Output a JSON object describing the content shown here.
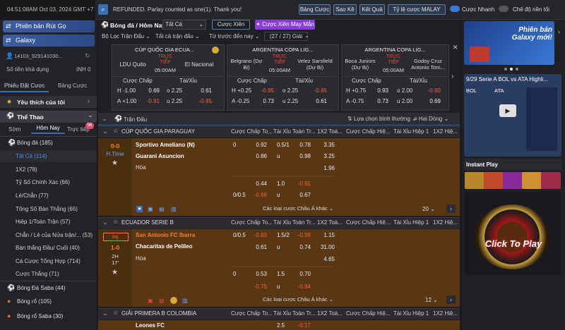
{
  "topbar": {
    "clock": "04:51:08AM Oct 03, 2024 GMT +7",
    "notice": "REFUNDED. Parlay counted as one(1). Thank you!",
    "buttons": [
      "Bảng Cược",
      "Sao Kê",
      "Kết Quả",
      "Tỷ lệ cược MALAY"
    ],
    "quick_bet_label": "Cược Nhanh",
    "dark_mode_label": "Chế độ nền tối"
  },
  "sidebar": {
    "promo1": "Phiên bản Rút Gọ",
    "promo2": "Galaxy",
    "user_id": "14103_929141030...",
    "balance_label": "Số tiền khả dụng",
    "balance_value": "INH 0",
    "tabs": [
      "Phiếu Đặt Cược",
      "Bảng Cược"
    ],
    "favorites": "Yêu thích của tôi",
    "sports_label": "Thể Thao",
    "time_tabs": [
      "Sớm",
      "Hôm Nay",
      "Trực tiếp"
    ],
    "live_badge": "56",
    "football": {
      "label": "Bóng đá",
      "count": "(185)"
    },
    "sub_items": [
      {
        "label": "Tất Cả",
        "count": "(114)"
      },
      {
        "label": "1X2",
        "count": "(78)"
      },
      {
        "label": "Tỷ Số Chính Xác",
        "count": "(66)"
      },
      {
        "label": "Lẻ/Chẵn",
        "count": "(77)"
      },
      {
        "label": "Tổng Số Bàn Thắng",
        "count": "(65)"
      },
      {
        "label": "Hiệp 1/Toàn Trận",
        "count": "(57)"
      },
      {
        "label": "Chẵn / Lẻ của Nửa trận/...",
        "count": "(53)"
      },
      {
        "label": "Bàn thắng Đầu/ Cuối",
        "count": "(40)"
      },
      {
        "label": "Cá Cược Tổng Hợp",
        "count": "(714)"
      },
      {
        "label": "Cược Thắng",
        "count": "(71)"
      }
    ],
    "other_sports": [
      {
        "label": "Bóng Đá Saba",
        "count": "(44)"
      },
      {
        "label": "Bóng rổ",
        "count": "(105)"
      },
      {
        "label": "Bóng rổ Saba",
        "count": "(30)"
      }
    ]
  },
  "main": {
    "breadcrumb": "Bóng đá / Hôm Nay",
    "filter_all": "Tất Cả",
    "parlay_btn": "Cược Xiên",
    "lucky_parlay_btn": "Cược Xiên May Mắn",
    "filters": [
      "Bộ Lọc Trận Đấu",
      "Tất cả trận đấu",
      "Từ trước đến nay",
      "(27 / 27) Giải"
    ],
    "live_label": "TRỰC TIẾP",
    "featured": [
      {
        "league": "CÚP QUỐC GIA ECUA...",
        "home": "LDU Quito",
        "away": "El Nacional",
        "time": "05:00AM",
        "hdp_label": "Cược Chấp",
        "ou_label": "Tài/Xỉu",
        "rows": [
          [
            "H",
            "-1.00",
            "0.69",
            "o",
            "2.25",
            "0.61"
          ],
          [
            "A",
            "+1.00",
            "-0.91",
            "u",
            "2.25",
            "-0.85"
          ]
        ]
      },
      {
        "league": "ARGENTINA COPA LIG...",
        "home": "Belgrano (Dự Bị)",
        "away": "Velez Sarsfield (Dự Bị)",
        "time": "05:00AM",
        "hdp_label": "Cược Chấp",
        "ou_label": "Tài/Xỉu",
        "rows": [
          [
            "H",
            "+0.25",
            "-0.95",
            "o",
            "2.25",
            "-0.85"
          ],
          [
            "A",
            "-0.25",
            "0.73",
            "u",
            "2.25",
            "0.61"
          ]
        ]
      },
      {
        "league": "ARGENTINA COPA LIG...",
        "home": "Boca Juniors (Dự Bị)",
        "away": "Godoy Cruz Antonio Tom...",
        "time": "05:00AM",
        "hdp_label": "Cược Chấp",
        "ou_label": "Tài/Xỉu",
        "rows": [
          [
            "H",
            "+0.75",
            "0.93",
            "o",
            "2.00",
            "-0.90"
          ],
          [
            "A",
            "-0.75",
            "0.73",
            "u",
            "2.00",
            "0.69"
          ]
        ]
      }
    ],
    "match_bar": {
      "label": "Trận Đấu",
      "sort": "Lựa chọn bình thường",
      "rows": "Hai Dòng"
    },
    "columns": [
      "Cược Chấp To...",
      "Tài Xỉu Toàn Tr...",
      "1X2 Toà...",
      "Cược Chấp Hiệ...",
      "Tài Xỉu Hiệp 1",
      "1X2 Hiệ..."
    ],
    "leagues": [
      {
        "name": "CÚP QUỐC GIA PARAGUAY"
      },
      {
        "name": "ECUADOR SERIE B"
      },
      {
        "name": "GIẢI PRIMERA B COLOMBIA"
      }
    ],
    "match1": {
      "score": "0-0",
      "status": "H.Time",
      "home": "Sportivo Ameliano (N)",
      "away": "Guarani Asuncion",
      "draw": "Hòa",
      "r1": [
        "0",
        "0.92",
        "0.5/1",
        "0.78",
        "3.35"
      ],
      "r2": [
        "0.86",
        "u",
        "0.98",
        "3.25"
      ],
      "r3": [
        "1.96"
      ],
      "r4": [
        "0.44",
        "1.0",
        "-0.91"
      ],
      "r5": [
        "0/0.5",
        "-0.66",
        "u",
        "0.67"
      ],
      "more": "Các loại cược Châu Á khác",
      "count": "20"
    },
    "match2": {
      "score": "1-0",
      "inj": "Inj.",
      "half": "2H",
      "minute": "17'",
      "home": "San Antonio FC Ibarra",
      "away": "Chacaritas de Pelileo",
      "draw": "Hòa",
      "r1": [
        "0/0.5",
        "-0.83",
        "1.5/2",
        "-0.98",
        "1.15"
      ],
      "r2": [
        "0.61",
        "u",
        "0.74",
        "31.00"
      ],
      "r3": [
        "4.65"
      ],
      "r4": [
        "0",
        "0.53",
        "1.5",
        "0.70"
      ],
      "r5": [
        "-0.75",
        "u",
        "-0.94"
      ],
      "more": "Các loại cược Châu Á khác",
      "count": "12"
    },
    "match3": {
      "home": "Leones FC",
      "r1": [
        "2.5",
        "-0.17"
      ]
    }
  },
  "right": {
    "banner1": "Phiên bản Galaxy mới!",
    "video_title": "9/29 Serie A BOL vs ATA Highli...",
    "teams": [
      "BOL",
      "ATA"
    ],
    "instant_play": "Instant Play",
    "click_to_play": "Click To Play"
  },
  "colors": {
    "accent": "#3d6bb0",
    "live_red": "#ff3b30",
    "odds_red": "#ff5a3c",
    "panel_orange": "#5a3714",
    "purple": "#8a3dd6"
  }
}
